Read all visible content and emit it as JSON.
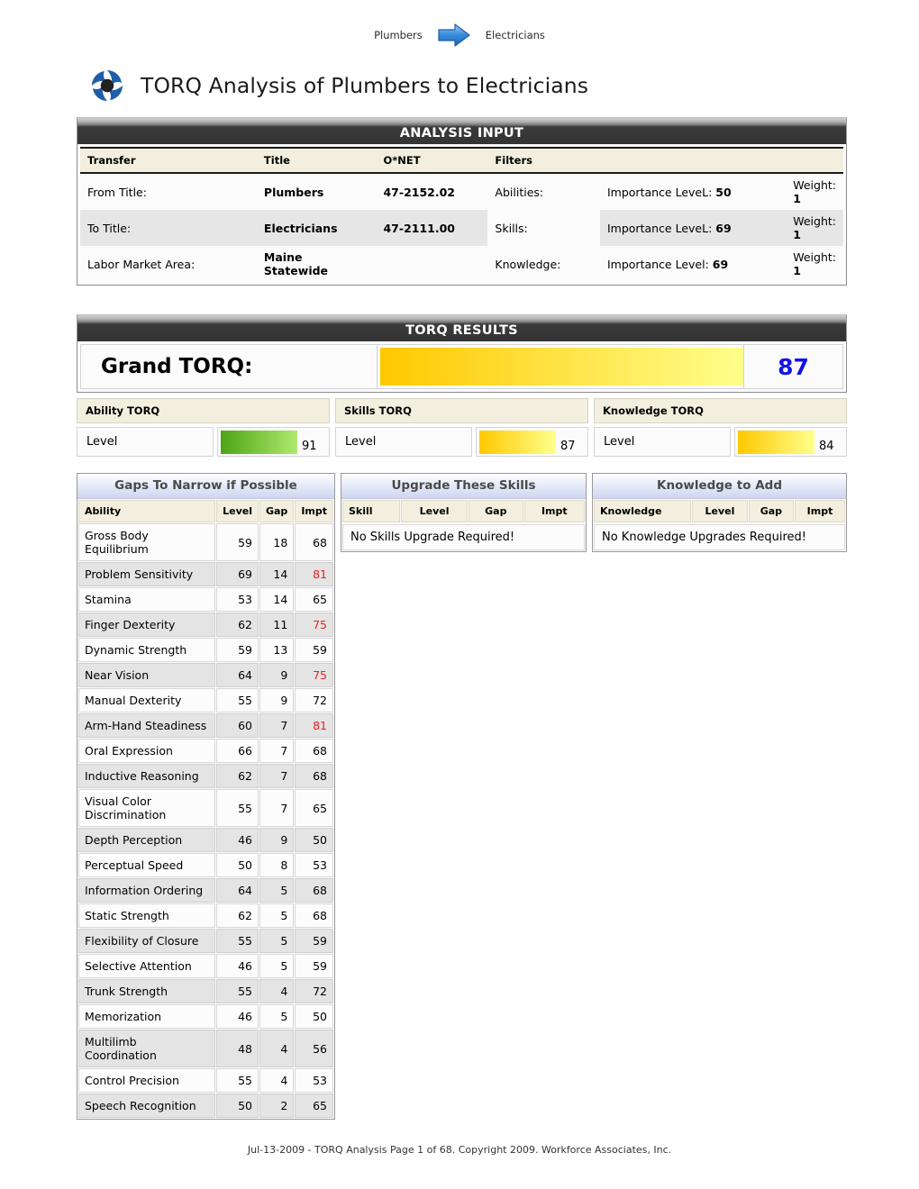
{
  "crumb": {
    "from": "Plumbers",
    "to": "Electricians",
    "arrow_icon": "right-arrow-icon"
  },
  "header": {
    "logo_icon": "torq-pinwheel-logo",
    "title": "TORQ Analysis of Plumbers to Electricians"
  },
  "analysis_input": {
    "band_label": "ANALYSIS INPUT",
    "headers": [
      "Transfer",
      "Title",
      "O*NET",
      "Filters"
    ],
    "rows": [
      {
        "transfer": "From Title:",
        "title": "Plumbers",
        "onet": "47-2152.02",
        "filter_label": "Abilities:",
        "importance": "Importance LeveL: ",
        "importance_value": "50",
        "weight": "Weight: ",
        "weight_value": "1"
      },
      {
        "transfer": "To Title:",
        "title": "Electricians",
        "onet": "47-2111.00",
        "filter_label": "Skills:",
        "importance": "Importance LeveL: ",
        "importance_value": "69",
        "weight": "Weight: ",
        "weight_value": "1"
      },
      {
        "transfer": "Labor Market Area:",
        "title": "Maine Statewide",
        "onet": "",
        "filter_label": "Knowledge:",
        "importance": "Importance Level: ",
        "importance_value": "69",
        "weight": "Weight: ",
        "weight_value": "1"
      }
    ]
  },
  "torq_results": {
    "band_label": "TORQ RESULTS",
    "grand": {
      "label": "Grand TORQ:",
      "score": "87",
      "bar_percent": 100,
      "bar_color_start": "#FFC800",
      "bar_color_end": "#FFFF8C"
    },
    "subpanels": [
      {
        "title": "Ability TORQ",
        "level_label": "Level",
        "score": "91",
        "bar_color_start": "#4CA513",
        "bar_color_end": "#AEE96F"
      },
      {
        "title": "Skills TORQ",
        "level_label": "Level",
        "score": "87",
        "bar_color_start": "#FFC800",
        "bar_color_end": "#FFFF8C"
      },
      {
        "title": "Knowledge TORQ",
        "level_label": "Level",
        "score": "84",
        "bar_color_start": "#FFC800",
        "bar_color_end": "#FFFF8C"
      }
    ]
  },
  "gaps_table": {
    "section_title": "Gaps To Narrow if Possible",
    "columns": [
      "Ability",
      "Level",
      "Gap",
      "Impt"
    ],
    "rows": [
      {
        "name": "Gross Body Equilibrium",
        "level": "59",
        "gap": "18",
        "impt": "68",
        "impt_red": false
      },
      {
        "name": "Problem Sensitivity",
        "level": "69",
        "gap": "14",
        "impt": "81",
        "impt_red": true
      },
      {
        "name": "Stamina",
        "level": "53",
        "gap": "14",
        "impt": "65",
        "impt_red": false
      },
      {
        "name": "Finger Dexterity",
        "level": "62",
        "gap": "11",
        "impt": "75",
        "impt_red": true
      },
      {
        "name": "Dynamic Strength",
        "level": "59",
        "gap": "13",
        "impt": "59",
        "impt_red": false
      },
      {
        "name": "Near Vision",
        "level": "64",
        "gap": "9",
        "impt": "75",
        "impt_red": true
      },
      {
        "name": "Manual Dexterity",
        "level": "55",
        "gap": "9",
        "impt": "72",
        "impt_red": false
      },
      {
        "name": "Arm-Hand Steadiness",
        "level": "60",
        "gap": "7",
        "impt": "81",
        "impt_red": true
      },
      {
        "name": "Oral Expression",
        "level": "66",
        "gap": "7",
        "impt": "68",
        "impt_red": false
      },
      {
        "name": "Inductive Reasoning",
        "level": "62",
        "gap": "7",
        "impt": "68",
        "impt_red": false
      },
      {
        "name": "Visual Color Discrimination",
        "level": "55",
        "gap": "7",
        "impt": "65",
        "impt_red": false
      },
      {
        "name": "Depth Perception",
        "level": "46",
        "gap": "9",
        "impt": "50",
        "impt_red": false
      },
      {
        "name": "Perceptual Speed",
        "level": "50",
        "gap": "8",
        "impt": "53",
        "impt_red": false
      },
      {
        "name": "Information Ordering",
        "level": "64",
        "gap": "5",
        "impt": "68",
        "impt_red": false
      },
      {
        "name": "Static Strength",
        "level": "62",
        "gap": "5",
        "impt": "68",
        "impt_red": false
      },
      {
        "name": "Flexibility of Closure",
        "level": "55",
        "gap": "5",
        "impt": "59",
        "impt_red": false
      },
      {
        "name": "Selective Attention",
        "level": "46",
        "gap": "5",
        "impt": "59",
        "impt_red": false
      },
      {
        "name": "Trunk Strength",
        "level": "55",
        "gap": "4",
        "impt": "72",
        "impt_red": false
      },
      {
        "name": "Memorization",
        "level": "46",
        "gap": "5",
        "impt": "50",
        "impt_red": false
      },
      {
        "name": "Multilimb Coordination",
        "level": "48",
        "gap": "4",
        "impt": "56",
        "impt_red": false
      },
      {
        "name": "Control Precision",
        "level": "55",
        "gap": "4",
        "impt": "53",
        "impt_red": false
      },
      {
        "name": "Speech Recognition",
        "level": "50",
        "gap": "2",
        "impt": "65",
        "impt_red": false
      }
    ]
  },
  "skills_table": {
    "section_title": "Upgrade These Skills",
    "columns": [
      "Skill",
      "Level",
      "Gap",
      "Impt"
    ],
    "empty_message": "No Skills Upgrade Required!"
  },
  "knowledge_table": {
    "section_title": "Knowledge to Add",
    "columns": [
      "Knowledge",
      "Level",
      "Gap",
      "Impt"
    ],
    "empty_message": "No Knowledge Upgrades Required!"
  },
  "footer": {
    "text": "Jul-13-2009 - TORQ Analysis Page 1 of 68. Copyright 2009. Workforce Associates, Inc."
  }
}
